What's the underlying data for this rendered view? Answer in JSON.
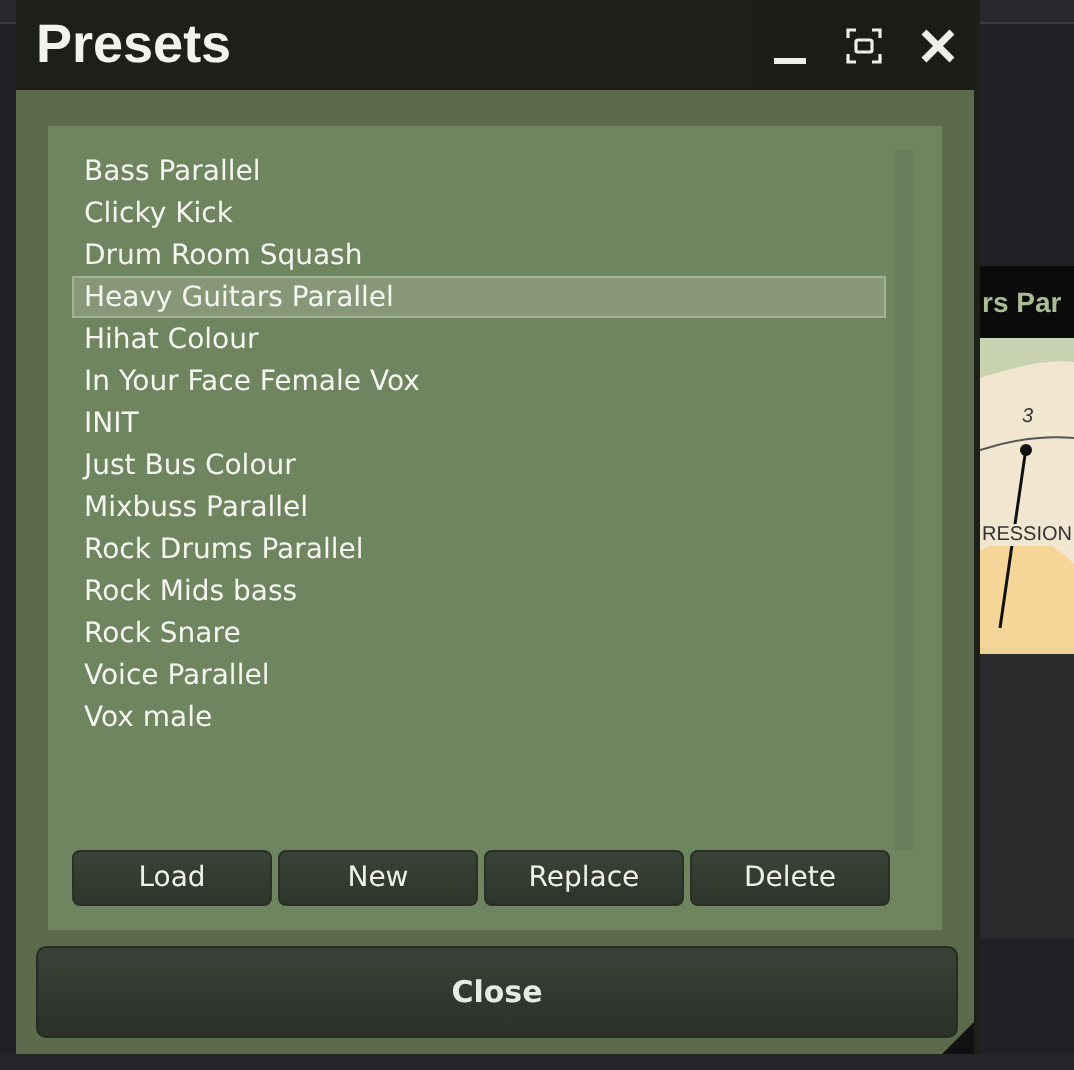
{
  "window": {
    "title": "Presets"
  },
  "title_buttons": [
    {
      "kind": "minimize"
    },
    {
      "kind": "maximize"
    },
    {
      "kind": "close"
    }
  ],
  "presets": [
    {
      "label": "Bass Parallel",
      "selected": false
    },
    {
      "label": "Clicky Kick",
      "selected": false
    },
    {
      "label": "Drum Room Squash",
      "selected": false
    },
    {
      "label": "Heavy Guitars Parallel",
      "selected": true
    },
    {
      "label": "Hihat Colour",
      "selected": false
    },
    {
      "label": "In Your Face Female Vox",
      "selected": false
    },
    {
      "label": "INIT",
      "selected": false
    },
    {
      "label": "Just Bus Colour",
      "selected": false
    },
    {
      "label": "Mixbuss Parallel",
      "selected": false
    },
    {
      "label": "Rock Drums Parallel",
      "selected": false
    },
    {
      "label": "Rock Mids bass",
      "selected": false
    },
    {
      "label": "Rock Snare",
      "selected": false
    },
    {
      "label": "Voice Parallel",
      "selected": false
    },
    {
      "label": "Vox male",
      "selected": false
    }
  ],
  "actions": [
    "Load",
    "New",
    "Replace",
    "Delete"
  ],
  "close_button": "Close",
  "background": {
    "header": "rs Par",
    "meter_tick": "3",
    "meter_label": "RESSION"
  }
}
